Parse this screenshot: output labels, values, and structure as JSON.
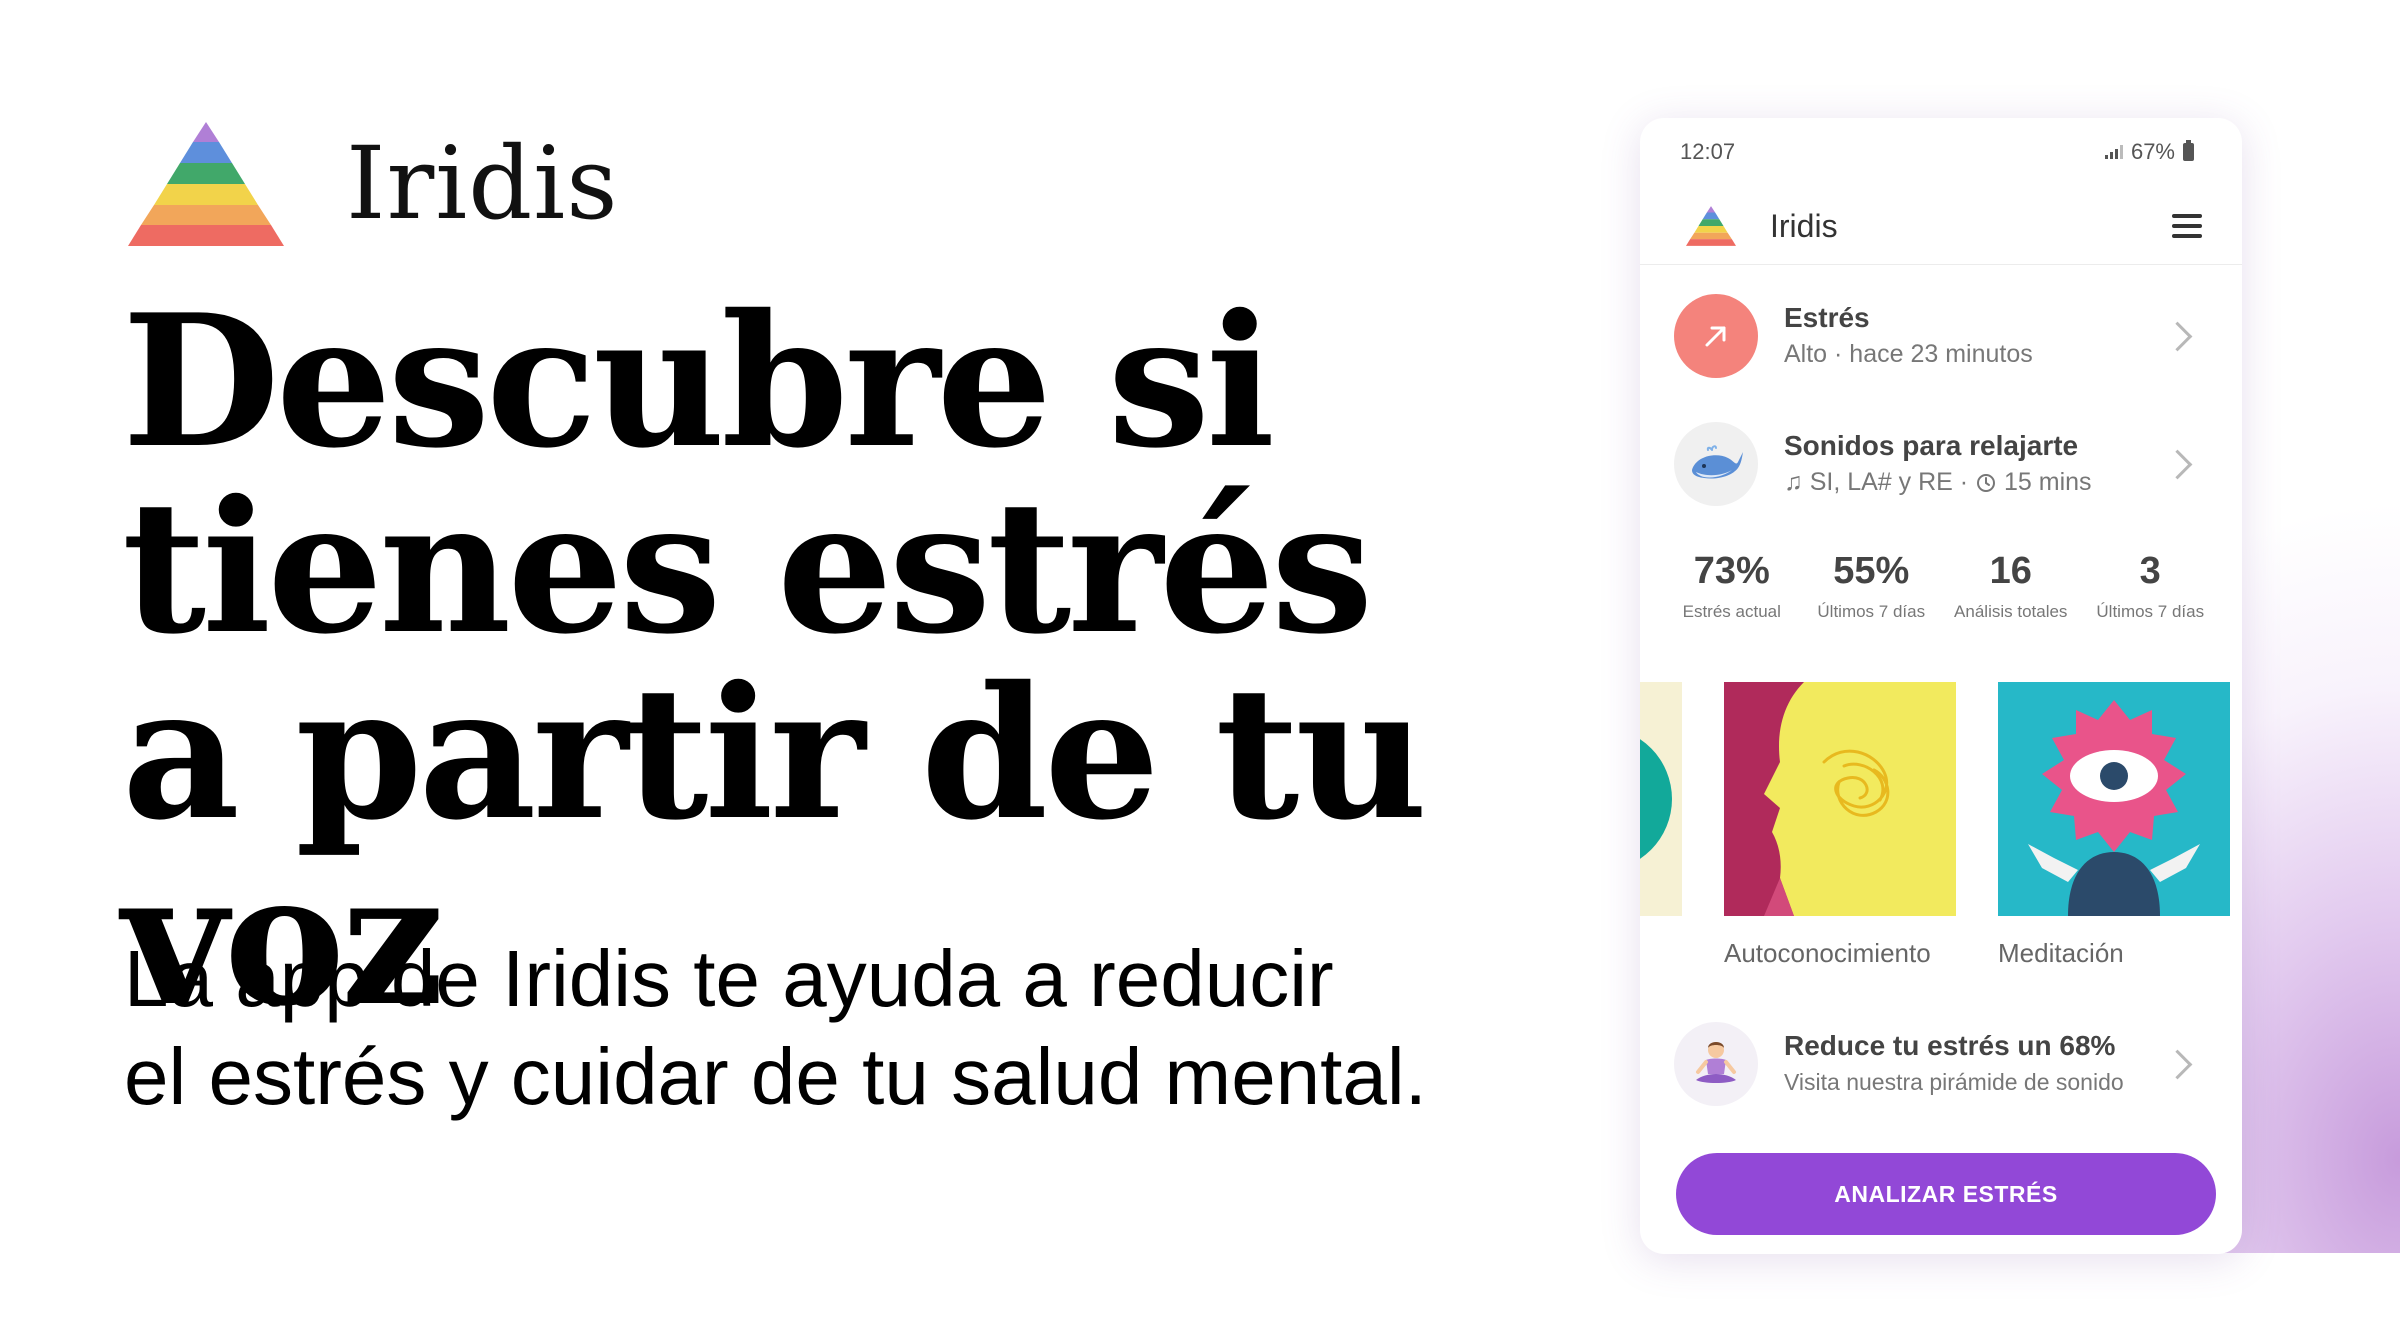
{
  "brand": {
    "name": "Iridis"
  },
  "hero": {
    "headline": "Descubre si tienes estrés a partir de tu voz",
    "subhead_line1": "La app de Iridis te ayuda a reducir",
    "subhead_line2": "el estrés y cuidar de tu salud mental."
  },
  "phone": {
    "status": {
      "time": "12:07",
      "battery": "67%"
    },
    "appbar": {
      "title": "Iridis"
    },
    "stress_row": {
      "title": "Estrés",
      "subtitle": "Alto · hace 23 minutos"
    },
    "sounds_row": {
      "title": "Sonidos para relajarte",
      "notes": "SI, LA# y RE ·",
      "duration": "15 mins"
    },
    "stats": [
      {
        "value": "73%",
        "label": "Estrés actual"
      },
      {
        "value": "55%",
        "label": "Últimos 7 días"
      },
      {
        "value": "16",
        "label": "Análisis totales"
      },
      {
        "value": "3",
        "label": "Últimos 7 días"
      }
    ],
    "cards": [
      {
        "label": "Autoconocimiento"
      },
      {
        "label": "Meditación"
      }
    ],
    "reduce_row": {
      "title": "Reduce tu estrés un 68%",
      "subtitle": "Visita nuestra pirámide de sonido"
    },
    "cta": {
      "label": "ANALIZAR ESTRÉS"
    }
  },
  "colors": {
    "accent": "#9248d7",
    "stress_badge": "#f4837c",
    "pyramid": [
      "#b07fd6",
      "#5e8fdc",
      "#41a86a",
      "#f2d34a",
      "#f2a65a",
      "#ee6b62"
    ]
  }
}
